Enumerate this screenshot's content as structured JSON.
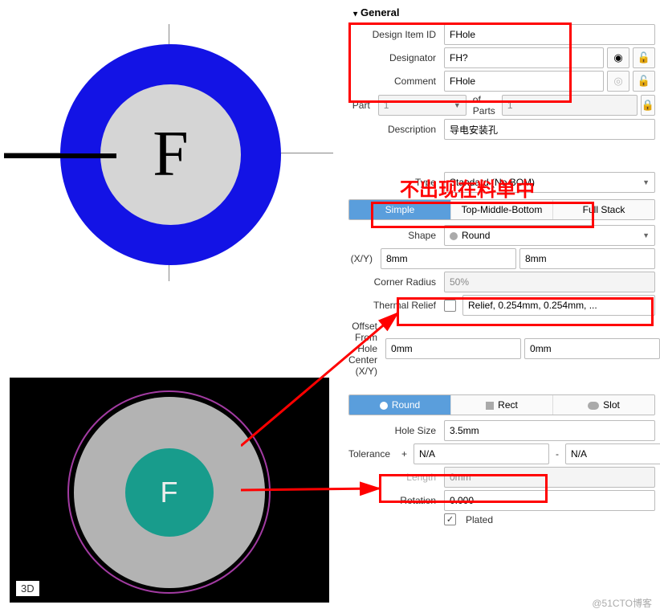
{
  "schematic": {
    "letter": "F"
  },
  "pcb": {
    "letter": "F",
    "badge": "3D"
  },
  "general": {
    "header": "General",
    "design_item_id_label": "Design Item ID",
    "design_item_id": "FHole",
    "designator_label": "Designator",
    "designator": "FH?",
    "comment_label": "Comment",
    "comment": "FHole",
    "part_label": "Part",
    "part": "1",
    "of_parts_label": "of Parts",
    "of_parts": "1",
    "description_label": "Description",
    "description": "导电安装孔",
    "type_label": "Type",
    "type": "Standard (No BOM)"
  },
  "annotation_text": "不出现在料单中",
  "pad_tabs": {
    "simple": "Simple",
    "tmb": "Top-Middle-Bottom",
    "full": "Full Stack"
  },
  "pad": {
    "shape_label": "Shape",
    "shape": "Round",
    "xy_label": "(X/Y)",
    "x": "8mm",
    "y": "8mm",
    "corner_radius_label": "Corner Radius",
    "corner_radius": "50%",
    "thermal_relief_label": "Thermal Relief",
    "thermal_relief": "Relief, 0.254mm, 0.254mm, ...",
    "offset_label": "Offset From Hole Center (X/Y)",
    "offset_x": "0mm",
    "offset_y": "0mm"
  },
  "hole_tabs": {
    "round": "Round",
    "rect": "Rect",
    "slot": "Slot"
  },
  "hole": {
    "size_label": "Hole Size",
    "size": "3.5mm",
    "tolerance_label": "Tolerance",
    "tol_plus_lbl": "+",
    "tol_plus": "N/A",
    "tol_minus_lbl": "-",
    "tol_minus": "N/A",
    "length_label": "Length",
    "length": "0mm",
    "rotation_label": "Rotation",
    "rotation": "0.000",
    "plated_label": "Plated"
  },
  "watermark": "@51CTO博客"
}
